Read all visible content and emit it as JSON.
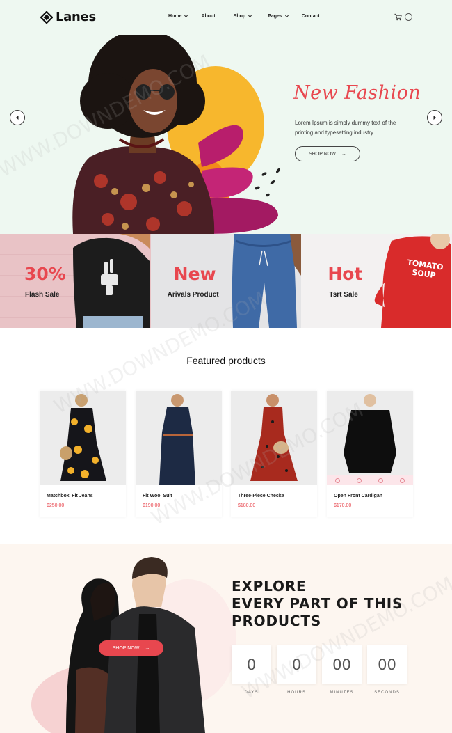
{
  "brand": {
    "name": "Lanes"
  },
  "nav": [
    {
      "label": "Home",
      "dropdown": true
    },
    {
      "label": "About",
      "dropdown": false
    },
    {
      "label": "Shop",
      "dropdown": true
    },
    {
      "label": "Pages",
      "dropdown": true
    },
    {
      "label": "Contact",
      "dropdown": false
    }
  ],
  "hero": {
    "script_title": "New Fashion",
    "description": "Lorem Ipsum is simply dummy text of the printing and typesetting industry.",
    "button": "SHOP NOW"
  },
  "banners": [
    {
      "big": "30%",
      "small": "Flash Sale"
    },
    {
      "big": "New",
      "small": "Arivals Product"
    },
    {
      "big": "Hot",
      "small": "Tsrt Sale"
    }
  ],
  "banner_shirt_text": [
    "TOMATO",
    "SOUP"
  ],
  "featured": {
    "title": "Featured products",
    "products": [
      {
        "name": "Matchbox' Fit Jeans",
        "price": "$250.00"
      },
      {
        "name": "Fit Wool Suit",
        "price": "$190.00"
      },
      {
        "name": "Three-Piece Checke",
        "price": "$180.00"
      },
      {
        "name": "Open Front Cardigan",
        "price": "$170.00"
      }
    ]
  },
  "countdown": {
    "title_lines": [
      "EXPLORE",
      "EVERY PART OF THIS",
      "PRODUCTS"
    ],
    "button": "SHOP NOW",
    "units": [
      {
        "value": "0",
        "label": "DAYS"
      },
      {
        "value": "0",
        "label": "HOURS"
      },
      {
        "value": "00",
        "label": "MINUTES"
      },
      {
        "value": "00",
        "label": "SECONDS"
      }
    ]
  },
  "watermark": "WWW.DOWNDEMO.COM",
  "colors": {
    "accent": "#e8474f",
    "hero_bg": "#eef8f1",
    "section_bg": "#fdf6f0"
  }
}
